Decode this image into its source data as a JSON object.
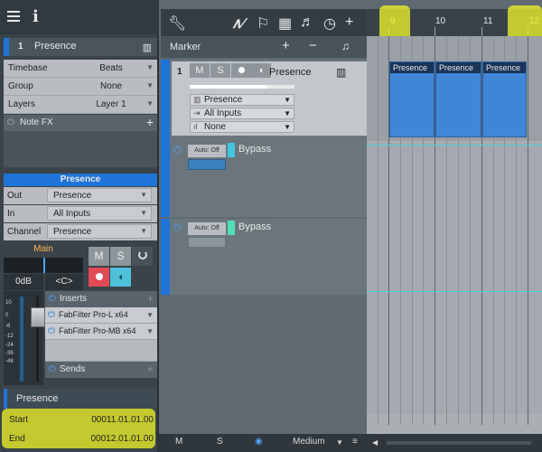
{
  "inspector": {
    "track_number": "1",
    "track_name": "Presence",
    "properties": [
      {
        "label": "Timebase",
        "value": "Beats"
      },
      {
        "label": "Group",
        "value": "None"
      },
      {
        "label": "Layers",
        "value": "Layer 1"
      }
    ],
    "note_fx_label": "Note FX",
    "channel": {
      "name": "Presence",
      "io": [
        {
          "label": "Out",
          "value": "Presence"
        },
        {
          "label": "In",
          "value": "All Inputs"
        },
        {
          "label": "Channel",
          "value": "Presence"
        }
      ],
      "main_label": "Main",
      "volume": "0dB",
      "pan": "<C>",
      "mute": "M",
      "solo": "S",
      "meter_scale": [
        "10",
        "0",
        "-6",
        "-12",
        "-24",
        "-36",
        "-48"
      ],
      "inserts_label": "Inserts",
      "plugins": [
        "FabFilter Pro-L x64",
        "FabFilter Pro-MB x64"
      ],
      "sends_label": "Sends"
    },
    "event": {
      "name": "Presence",
      "start_label": "Start",
      "start_value": "00011.01.01.00",
      "end_label": "End",
      "end_value": "00012.01.01.00"
    }
  },
  "arrange": {
    "marker_label": "Marker",
    "track": {
      "number": "1",
      "name": "Presence",
      "mute": "M",
      "solo": "S",
      "instrument": "Presence",
      "input": "All Inputs",
      "channel": "None",
      "level": 0.74
    },
    "automation_tracks": [
      {
        "mode": "Auto: Off",
        "name": "Bypass",
        "color": "#3fc6e0"
      },
      {
        "mode": "Auto: Off",
        "name": "Bypass",
        "color": "#4fe0b5"
      }
    ],
    "ruler": [
      "9",
      "10",
      "11",
      "12"
    ],
    "clips": [
      "Presence",
      "Presence",
      "Presence"
    ]
  },
  "bottom": {
    "mute": "M",
    "solo": "S",
    "zoom": "Medium"
  },
  "colors": {
    "accent": "#1f74d8",
    "highlight": "#ecf028",
    "record": "#e24a55",
    "monitor": "#4ec1d8"
  }
}
